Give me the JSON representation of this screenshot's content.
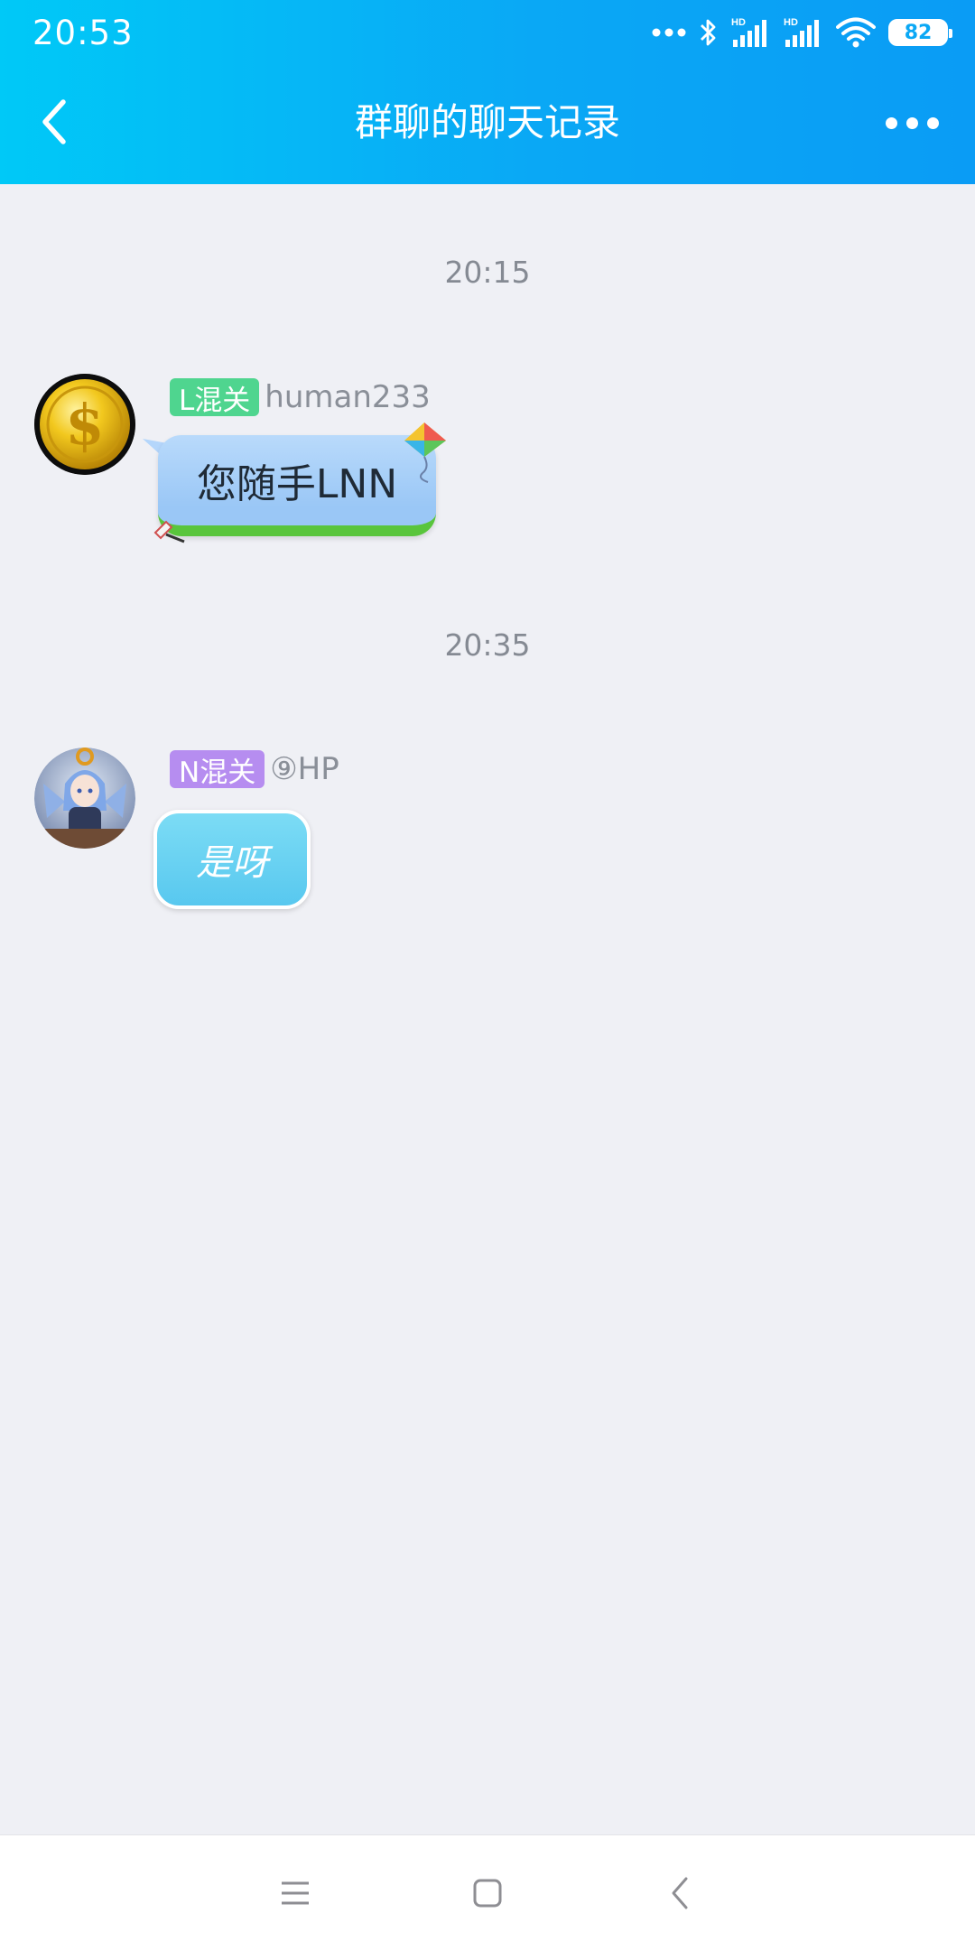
{
  "status_bar": {
    "time": "20:53",
    "battery": "82",
    "icons": [
      "more-dots-icon",
      "bluetooth-icon",
      "signal-hd-icon",
      "signal-hd-icon",
      "wifi-icon",
      "battery-icon"
    ]
  },
  "header": {
    "title": "群聊的聊天记录",
    "back_icon": "chevron-left-icon",
    "more_icon": "more-horizontal-icon"
  },
  "messages": [
    {
      "time": "20:15",
      "badge": "L混关",
      "badge_color": "#4fd58f",
      "sender": "human233",
      "text": "您随手LNN",
      "avatar": "gold-dollar-coin-avatar"
    },
    {
      "time": "20:35",
      "badge": "N混关",
      "badge_color": "#b68df0",
      "sender": "⑨HP",
      "text": "是呀",
      "avatar": "anime-girl-avatar"
    }
  ],
  "nav_bar": {
    "icons": [
      "menu-icon",
      "home-square-icon",
      "back-chevron-icon"
    ]
  }
}
